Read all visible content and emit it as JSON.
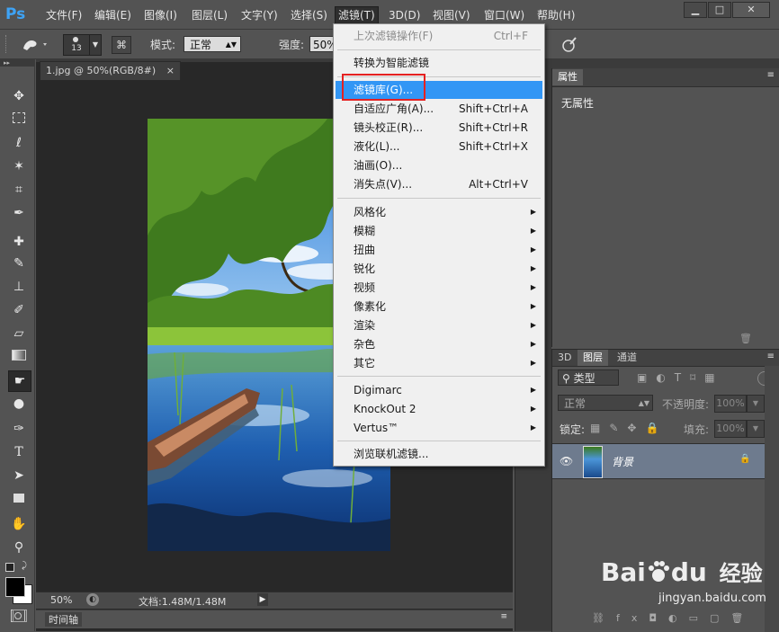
{
  "app": {
    "logo": "Ps"
  },
  "menubar": {
    "items": [
      "文件(F)",
      "编辑(E)",
      "图像(I)",
      "图层(L)",
      "文字(Y)",
      "选择(S)",
      "滤镜(T)",
      "3D(D)",
      "视图(V)",
      "窗口(W)",
      "帮助(H)"
    ],
    "active_index": 6
  },
  "window_controls": {
    "minimize": "▁",
    "restore": "□",
    "close": "✕"
  },
  "options_bar": {
    "brush_size": "13",
    "mode_label": "模式:",
    "mode_value": "正常",
    "strength_label": "强度:",
    "strength_value": "50%"
  },
  "document": {
    "tab_title": "1.jpg @ 50%(RGB/8#)",
    "tab_close": "×",
    "zoom": "50%",
    "doc_info": "文档:1.48M/1.48M"
  },
  "timeline": {
    "label": "时间轴"
  },
  "properties_panel": {
    "tab": "属性",
    "content": "无属性"
  },
  "layers_panel": {
    "tabs": [
      "3D",
      "图层",
      "通道"
    ],
    "active_tab": 1,
    "kind_filter": "类型",
    "blend_mode": "正常",
    "opacity_label": "不透明度:",
    "opacity_value": "100%",
    "lock_label": "锁定:",
    "fill_label": "填充:",
    "fill_value": "100%",
    "layers": [
      {
        "name": "背景"
      }
    ]
  },
  "filter_menu": {
    "items": [
      {
        "label": "上次滤镜操作(F)",
        "shortcut": "Ctrl+F",
        "disabled": true
      },
      {
        "label": "转换为智能滤镜"
      },
      {
        "label": "滤镜库(G)...",
        "highlighted": true
      },
      {
        "label": "自适应广角(A)...",
        "shortcut": "Shift+Ctrl+A"
      },
      {
        "label": "镜头校正(R)...",
        "shortcut": "Shift+Ctrl+R"
      },
      {
        "label": "液化(L)...",
        "shortcut": "Shift+Ctrl+X"
      },
      {
        "label": "油画(O)..."
      },
      {
        "label": "消失点(V)...",
        "shortcut": "Alt+Ctrl+V"
      },
      {
        "label": "风格化",
        "submenu": true
      },
      {
        "label": "模糊",
        "submenu": true
      },
      {
        "label": "扭曲",
        "submenu": true
      },
      {
        "label": "锐化",
        "submenu": true
      },
      {
        "label": "视频",
        "submenu": true
      },
      {
        "label": "像素化",
        "submenu": true
      },
      {
        "label": "渲染",
        "submenu": true
      },
      {
        "label": "杂色",
        "submenu": true
      },
      {
        "label": "其它",
        "submenu": true
      },
      {
        "label": "Digimarc",
        "submenu": true
      },
      {
        "label": "KnockOut 2",
        "submenu": true
      },
      {
        "label": "Vertus™",
        "submenu": true
      },
      {
        "label": "浏览联机滤镜..."
      }
    ]
  },
  "watermark": {
    "brand": "Bai",
    "brand2": "du",
    "cn": "经验",
    "url": "jingyan.baidu.com"
  },
  "colors": {
    "accent": "#3296f5",
    "ps_blue": "#3ea3f5",
    "highlight_box": "#e52121"
  }
}
